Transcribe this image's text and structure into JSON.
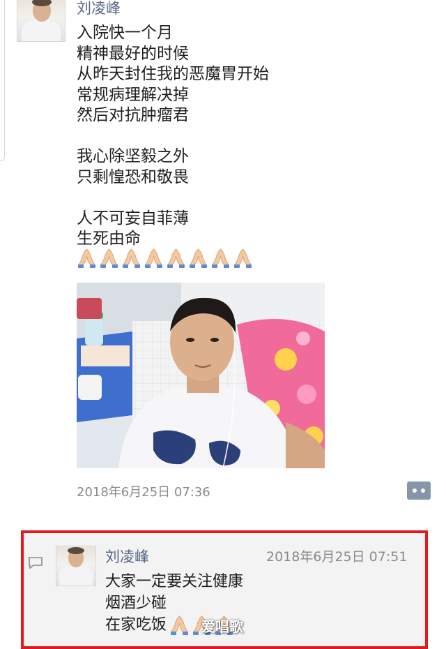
{
  "post": {
    "author": "刘凌峰",
    "lines": [
      "入院快一个月",
      "精神最好的时候",
      "从昨天封住我的恶魔胃开始",
      "常规病理解决掉",
      "然后对抗肿瘤君",
      "",
      "我心除坚毅之外",
      "只剩惶恐和敬畏",
      "",
      "人不可妄自菲薄",
      "生死由命"
    ],
    "emoji": [
      "folded-hands",
      "folded-hands",
      "folded-hands",
      "folded-hands",
      "folded-hands",
      "folded-hands",
      "folded-hands",
      "folded-hands"
    ],
    "photo": "selfie-in-hospital-bed",
    "timestamp": "2018年6月25日 07:36",
    "more_icon": "comment-more-icon"
  },
  "comment": {
    "author": "刘凌峰",
    "timestamp": "2018年6月25日 07:51",
    "lines": [
      "大家一定要关注健康",
      "烟酒少碰",
      "在家吃饭"
    ],
    "emoji": [
      "folded-hands",
      "folded-hands",
      "folded-hands"
    ],
    "highlight_color": "#e4191b"
  },
  "watermark": "爱唱歌"
}
